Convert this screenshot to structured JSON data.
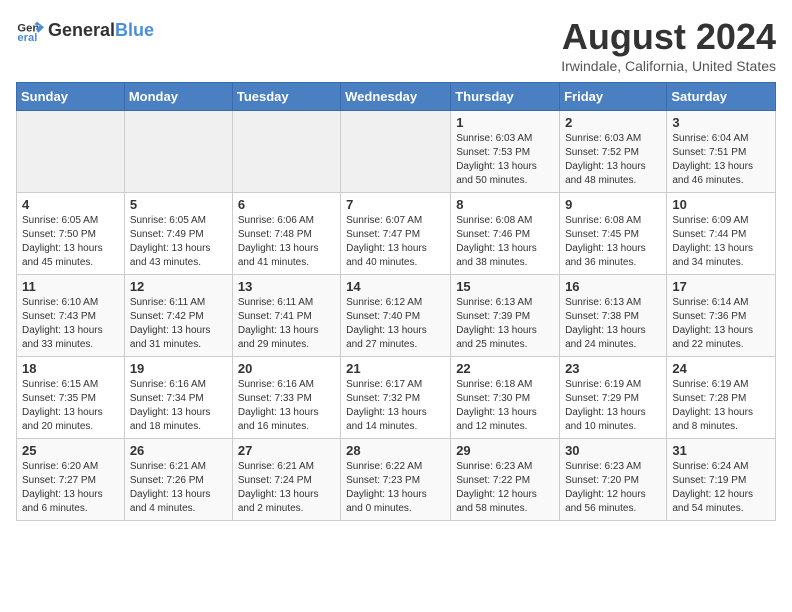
{
  "logo": {
    "general": "General",
    "blue": "Blue"
  },
  "title": "August 2024",
  "subtitle": "Irwindale, California, United States",
  "headers": [
    "Sunday",
    "Monday",
    "Tuesday",
    "Wednesday",
    "Thursday",
    "Friday",
    "Saturday"
  ],
  "weeks": [
    [
      {
        "day": "",
        "info": ""
      },
      {
        "day": "",
        "info": ""
      },
      {
        "day": "",
        "info": ""
      },
      {
        "day": "",
        "info": ""
      },
      {
        "day": "1",
        "info": "Sunrise: 6:03 AM\nSunset: 7:53 PM\nDaylight: 13 hours\nand 50 minutes."
      },
      {
        "day": "2",
        "info": "Sunrise: 6:03 AM\nSunset: 7:52 PM\nDaylight: 13 hours\nand 48 minutes."
      },
      {
        "day": "3",
        "info": "Sunrise: 6:04 AM\nSunset: 7:51 PM\nDaylight: 13 hours\nand 46 minutes."
      }
    ],
    [
      {
        "day": "4",
        "info": "Sunrise: 6:05 AM\nSunset: 7:50 PM\nDaylight: 13 hours\nand 45 minutes."
      },
      {
        "day": "5",
        "info": "Sunrise: 6:05 AM\nSunset: 7:49 PM\nDaylight: 13 hours\nand 43 minutes."
      },
      {
        "day": "6",
        "info": "Sunrise: 6:06 AM\nSunset: 7:48 PM\nDaylight: 13 hours\nand 41 minutes."
      },
      {
        "day": "7",
        "info": "Sunrise: 6:07 AM\nSunset: 7:47 PM\nDaylight: 13 hours\nand 40 minutes."
      },
      {
        "day": "8",
        "info": "Sunrise: 6:08 AM\nSunset: 7:46 PM\nDaylight: 13 hours\nand 38 minutes."
      },
      {
        "day": "9",
        "info": "Sunrise: 6:08 AM\nSunset: 7:45 PM\nDaylight: 13 hours\nand 36 minutes."
      },
      {
        "day": "10",
        "info": "Sunrise: 6:09 AM\nSunset: 7:44 PM\nDaylight: 13 hours\nand 34 minutes."
      }
    ],
    [
      {
        "day": "11",
        "info": "Sunrise: 6:10 AM\nSunset: 7:43 PM\nDaylight: 13 hours\nand 33 minutes."
      },
      {
        "day": "12",
        "info": "Sunrise: 6:11 AM\nSunset: 7:42 PM\nDaylight: 13 hours\nand 31 minutes."
      },
      {
        "day": "13",
        "info": "Sunrise: 6:11 AM\nSunset: 7:41 PM\nDaylight: 13 hours\nand 29 minutes."
      },
      {
        "day": "14",
        "info": "Sunrise: 6:12 AM\nSunset: 7:40 PM\nDaylight: 13 hours\nand 27 minutes."
      },
      {
        "day": "15",
        "info": "Sunrise: 6:13 AM\nSunset: 7:39 PM\nDaylight: 13 hours\nand 25 minutes."
      },
      {
        "day": "16",
        "info": "Sunrise: 6:13 AM\nSunset: 7:38 PM\nDaylight: 13 hours\nand 24 minutes."
      },
      {
        "day": "17",
        "info": "Sunrise: 6:14 AM\nSunset: 7:36 PM\nDaylight: 13 hours\nand 22 minutes."
      }
    ],
    [
      {
        "day": "18",
        "info": "Sunrise: 6:15 AM\nSunset: 7:35 PM\nDaylight: 13 hours\nand 20 minutes."
      },
      {
        "day": "19",
        "info": "Sunrise: 6:16 AM\nSunset: 7:34 PM\nDaylight: 13 hours\nand 18 minutes."
      },
      {
        "day": "20",
        "info": "Sunrise: 6:16 AM\nSunset: 7:33 PM\nDaylight: 13 hours\nand 16 minutes."
      },
      {
        "day": "21",
        "info": "Sunrise: 6:17 AM\nSunset: 7:32 PM\nDaylight: 13 hours\nand 14 minutes."
      },
      {
        "day": "22",
        "info": "Sunrise: 6:18 AM\nSunset: 7:30 PM\nDaylight: 13 hours\nand 12 minutes."
      },
      {
        "day": "23",
        "info": "Sunrise: 6:19 AM\nSunset: 7:29 PM\nDaylight: 13 hours\nand 10 minutes."
      },
      {
        "day": "24",
        "info": "Sunrise: 6:19 AM\nSunset: 7:28 PM\nDaylight: 13 hours\nand 8 minutes."
      }
    ],
    [
      {
        "day": "25",
        "info": "Sunrise: 6:20 AM\nSunset: 7:27 PM\nDaylight: 13 hours\nand 6 minutes."
      },
      {
        "day": "26",
        "info": "Sunrise: 6:21 AM\nSunset: 7:26 PM\nDaylight: 13 hours\nand 4 minutes."
      },
      {
        "day": "27",
        "info": "Sunrise: 6:21 AM\nSunset: 7:24 PM\nDaylight: 13 hours\nand 2 minutes."
      },
      {
        "day": "28",
        "info": "Sunrise: 6:22 AM\nSunset: 7:23 PM\nDaylight: 13 hours\nand 0 minutes."
      },
      {
        "day": "29",
        "info": "Sunrise: 6:23 AM\nSunset: 7:22 PM\nDaylight: 12 hours\nand 58 minutes."
      },
      {
        "day": "30",
        "info": "Sunrise: 6:23 AM\nSunset: 7:20 PM\nDaylight: 12 hours\nand 56 minutes."
      },
      {
        "day": "31",
        "info": "Sunrise: 6:24 AM\nSunset: 7:19 PM\nDaylight: 12 hours\nand 54 minutes."
      }
    ]
  ]
}
